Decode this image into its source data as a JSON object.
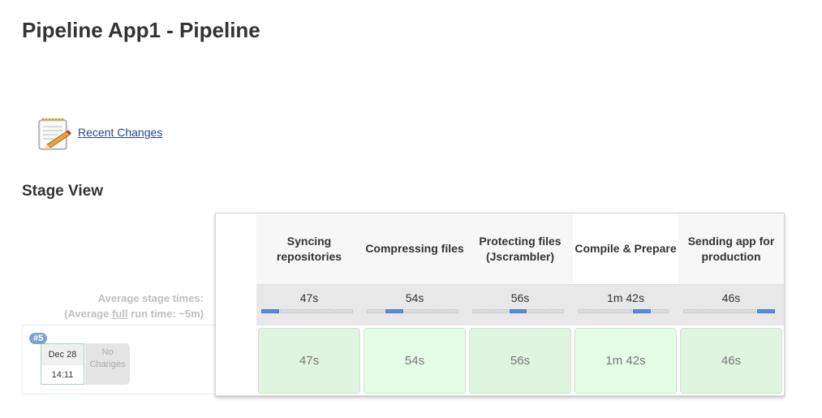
{
  "page": {
    "title": "Pipeline App1 - Pipeline",
    "recent_changes_label": "Recent Changes",
    "section_title": "Stage View"
  },
  "average": {
    "line1": "Average stage times:",
    "line2_prefix": "(Average ",
    "line2_full": "full",
    "line2_suffix": " run time: ~5m)"
  },
  "run": {
    "badge": "#5",
    "date": "Dec 28",
    "time": "14:11",
    "changes": "No Changes"
  },
  "stages": [
    {
      "name": "Syncing repositories",
      "avg": "47s",
      "duration": "47s",
      "bar_segment": 1
    },
    {
      "name": "Compressing files",
      "avg": "54s",
      "duration": "54s",
      "bar_segment": 2
    },
    {
      "name": "Protecting files (Jscrambler)",
      "avg": "56s",
      "duration": "56s",
      "bar_segment": 3
    },
    {
      "name": "Compile & Prepare",
      "avg": "1m 42s",
      "duration": "1m 42s",
      "bar_segment": 4
    },
    {
      "name": "Sending app for production",
      "avg": "46s",
      "duration": "46s",
      "bar_segment": 5
    }
  ],
  "colors": {
    "success_cell": "#dff5df",
    "progress_fill": "#5b8dd6",
    "badge": "#7fa3cf",
    "link": "#204a87"
  }
}
